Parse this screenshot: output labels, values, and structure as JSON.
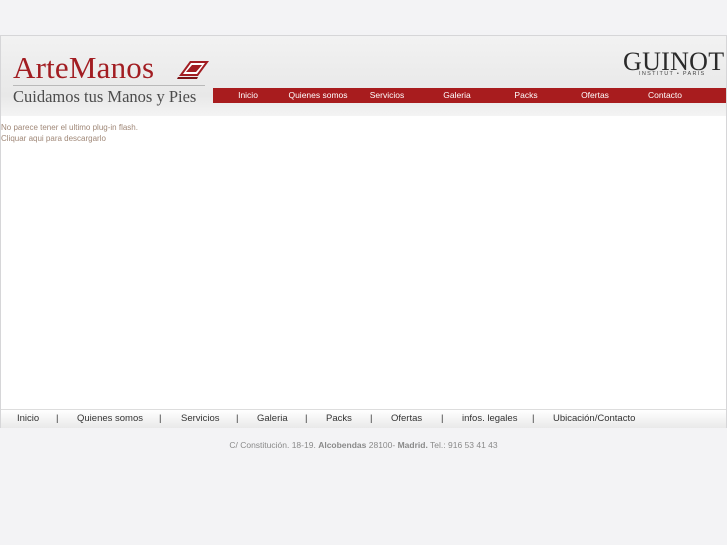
{
  "logo": {
    "title": "ArteManos",
    "tagline": "Cuidamos tus Manos y Pies"
  },
  "brand": {
    "name": "GUINOT",
    "sub": "INSTITUT • PARIS"
  },
  "nav": [
    {
      "label": "Inicio"
    },
    {
      "label": "Quienes somos"
    },
    {
      "label": "Servicios"
    },
    {
      "label": "Galeria"
    },
    {
      "label": "Packs"
    },
    {
      "label": "Ofertas"
    },
    {
      "label": "Contacto"
    }
  ],
  "content": {
    "flash_notice": "No parece tener el ultimo plug-in flash.",
    "download_link": "Cliquar aqui para descargarlo"
  },
  "footer_nav": [
    {
      "label": "Inicio"
    },
    {
      "label": "Quienes somos"
    },
    {
      "label": "Servicios"
    },
    {
      "label": "Galeria"
    },
    {
      "label": "Packs"
    },
    {
      "label": "Ofertas"
    },
    {
      "label": "infos. legales"
    },
    {
      "label": "Ubicación/Contacto"
    }
  ],
  "footer_separator": "|",
  "address": {
    "street": "C/ Constitución. 18-19.",
    "city": "Alcobendas",
    "postal": "28100-",
    "region": "Madrid.",
    "phone": "Tel.: 916 53 41 43"
  },
  "colors": {
    "nav_bg": "#a81c1e",
    "logo_red": "#a21d22",
    "notice_text": "#a08878"
  }
}
